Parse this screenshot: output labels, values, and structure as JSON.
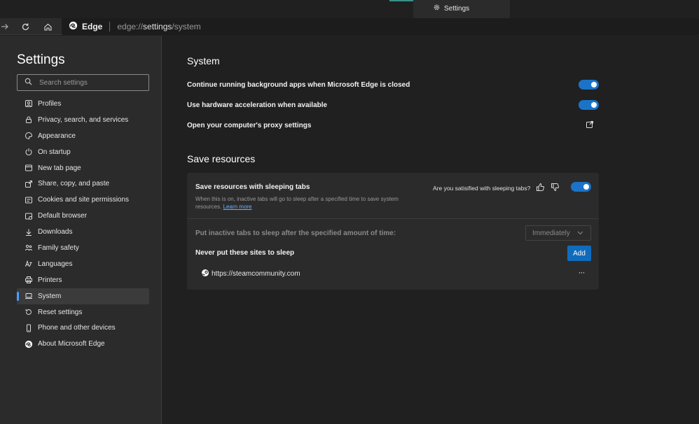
{
  "tab": {
    "title": "Settings",
    "icon": "gear-icon"
  },
  "toolbar": {
    "brand": "Edge",
    "url_prefix": "edge://",
    "url_main": "settings",
    "url_suffix": "/system"
  },
  "sidebar": {
    "title": "Settings",
    "search_placeholder": "Search settings",
    "items": [
      {
        "label": "Profiles",
        "icon": "profile-icon"
      },
      {
        "label": "Privacy, search, and services",
        "icon": "lock-icon"
      },
      {
        "label": "Appearance",
        "icon": "appearance-icon"
      },
      {
        "label": "On startup",
        "icon": "power-icon"
      },
      {
        "label": "New tab page",
        "icon": "new-tab-icon"
      },
      {
        "label": "Share, copy, and paste",
        "icon": "share-icon"
      },
      {
        "label": "Cookies and site permissions",
        "icon": "cookies-icon"
      },
      {
        "label": "Default browser",
        "icon": "default-browser-icon"
      },
      {
        "label": "Downloads",
        "icon": "download-icon"
      },
      {
        "label": "Family safety",
        "icon": "family-icon"
      },
      {
        "label": "Languages",
        "icon": "languages-icon"
      },
      {
        "label": "Printers",
        "icon": "printer-icon"
      },
      {
        "label": "System",
        "icon": "system-icon",
        "active": true
      },
      {
        "label": "Reset settings",
        "icon": "reset-icon"
      },
      {
        "label": "Phone and other devices",
        "icon": "phone-icon"
      },
      {
        "label": "About Microsoft Edge",
        "icon": "edge-logo-icon"
      }
    ]
  },
  "main": {
    "system_heading": "System",
    "settings": [
      {
        "label": "Continue running background apps when Microsoft Edge is closed",
        "control": "toggle",
        "on": true
      },
      {
        "label": "Use hardware acceleration when available",
        "control": "toggle",
        "on": true
      },
      {
        "label": "Open your computer's proxy settings",
        "control": "external-link"
      }
    ],
    "save_heading": "Save resources",
    "sleeping_tabs": {
      "title": "Save resources with sleeping tabs",
      "description": "When this is on, inactive tabs will go to sleep after a specified time to save system resources.",
      "learn_more": "Learn more",
      "feedback_question": "Are you satisified with sleeping tabs?",
      "on": true,
      "inactive_label": "Put inactive tabs to sleep after the specified amount of time:",
      "inactive_value": "Immediately",
      "never_label": "Never put these sites to sleep",
      "add_label": "Add",
      "sites": [
        "https://steamcommunity.com"
      ],
      "more_label": "···"
    }
  },
  "colors": {
    "accent": "#1a73c8",
    "add_button": "#0f6cbd",
    "link": "#6ab0ff"
  }
}
